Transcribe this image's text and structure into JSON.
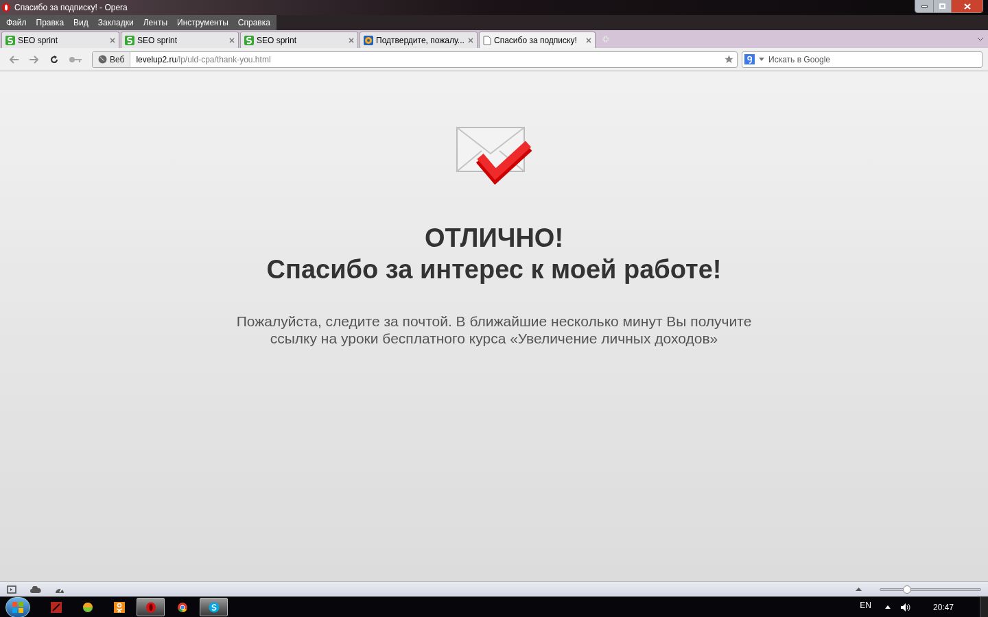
{
  "window": {
    "title": "Спасибо за подписку! - Opera"
  },
  "menu": [
    "Файл",
    "Правка",
    "Вид",
    "Закладки",
    "Ленты",
    "Инструменты",
    "Справка"
  ],
  "tabs": [
    {
      "label": "SEO sprint",
      "kind": "seo",
      "selected": false
    },
    {
      "label": "SEO sprint",
      "kind": "seo",
      "selected": false
    },
    {
      "label": "SEO sprint",
      "kind": "seo",
      "selected": false
    },
    {
      "label": "Подтвердите, пожалу...",
      "kind": "mail",
      "selected": false
    },
    {
      "label": "Спасибо за подписку!",
      "kind": "page",
      "selected": true
    }
  ],
  "address_bar": {
    "badge": "Веб",
    "domain": "levelup2.ru",
    "path": "/lp/uld-cpa/thank-you.html"
  },
  "search": {
    "placeholder": "Искать в Google"
  },
  "page": {
    "heading": "ОТЛИЧНО!",
    "subheading": "Спасибо за интерес к моей работе!",
    "text": "Пожалуйста, следите за почтой. В ближайшие несколько минут Вы получите ссылку на уроки бесплатного курса «Увеличение личных доходов»"
  },
  "status_bar": {
    "zoom": {
      "level": 0.27
    }
  },
  "taskbar": {
    "apps": [
      {
        "kind": "paint",
        "active": false
      },
      {
        "kind": "ball",
        "active": false
      },
      {
        "kind": "ok",
        "active": false
      },
      {
        "kind": "opera",
        "active": true
      },
      {
        "kind": "chrome",
        "active": false
      },
      {
        "kind": "skype",
        "active": true
      }
    ],
    "language": "EN",
    "clock": "20:47"
  }
}
